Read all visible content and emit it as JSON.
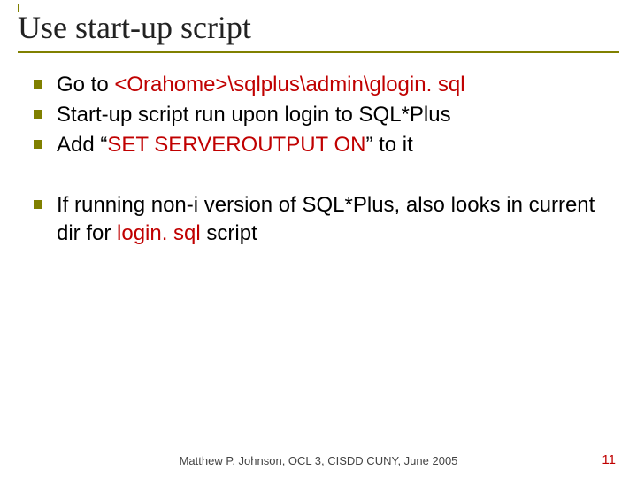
{
  "title": "Use start-up script",
  "bullets_group1": [
    {
      "pre": "Go to ",
      "hl": "<Orahome>\\sqlplus\\admin\\glogin. sql",
      "post": ""
    },
    {
      "pre": "Start-up script run upon login to SQL*Plus",
      "hl": "",
      "post": ""
    },
    {
      "pre": "Add “",
      "hl": "SET SERVEROUTPUT ON",
      "post": "” to it"
    }
  ],
  "bullets_group2": [
    {
      "pre": "If running non-i version of SQL*Plus, also looks in current dir for ",
      "hl": "login. sql",
      "post": " script"
    }
  ],
  "footer": "Matthew P. Johnson, OCL 3, CISDD CUNY, June 2005",
  "page_number": "11"
}
